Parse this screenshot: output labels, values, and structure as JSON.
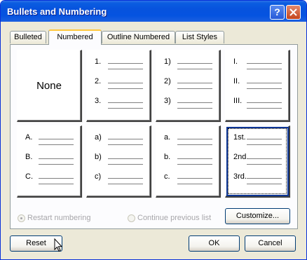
{
  "window": {
    "title": "Bullets and Numbering"
  },
  "tabs": [
    {
      "label": "Bulleted"
    },
    {
      "label": "Numbered"
    },
    {
      "label": "Outline Numbered"
    },
    {
      "label": "List Styles"
    }
  ],
  "gallery": {
    "none_label": "None",
    "cells": [
      {
        "markers": [
          "1.",
          "2.",
          "3."
        ]
      },
      {
        "markers": [
          "1)",
          "2)",
          "3)"
        ]
      },
      {
        "markers": [
          "I.",
          "II.",
          "III."
        ]
      },
      {
        "markers": [
          "A.",
          "B.",
          "C."
        ]
      },
      {
        "markers": [
          "a)",
          "b)",
          "c)"
        ]
      },
      {
        "markers": [
          "a.",
          "b.",
          "c."
        ]
      },
      {
        "markers": [
          "1st.",
          "2nd.",
          "3rd."
        ]
      }
    ],
    "selected_index": 7
  },
  "options": {
    "restart_label": "Restart numbering",
    "continue_label": "Continue previous list"
  },
  "buttons": {
    "customize": "Customize...",
    "reset": "Reset",
    "ok": "OK",
    "cancel": "Cancel"
  },
  "icons": {
    "help": "question-icon",
    "close": "close-icon",
    "pointer": "mouse-cursor-icon"
  }
}
